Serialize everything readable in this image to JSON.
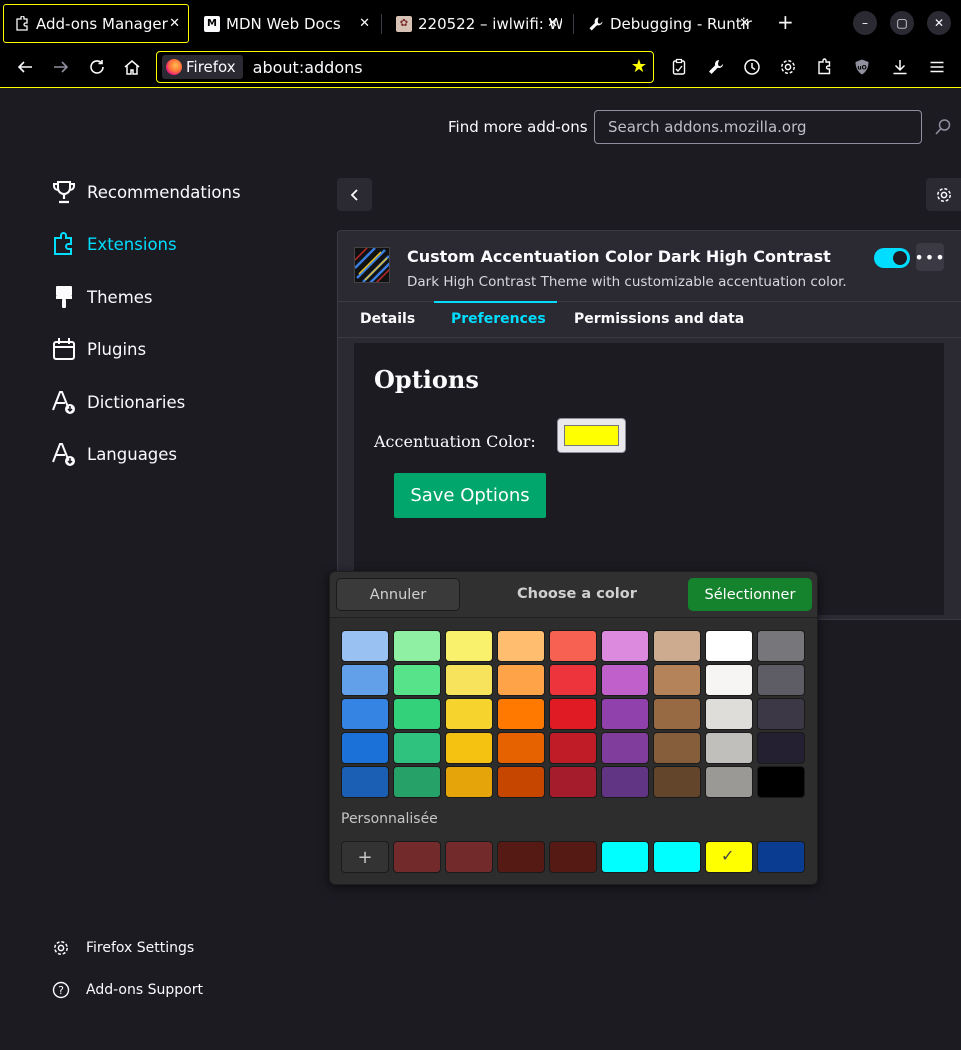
{
  "tabs": [
    {
      "label": "Add-ons Manager",
      "icon": "puzzle-icon",
      "active": true
    },
    {
      "label": "MDN Web Docs",
      "icon": "mdn-icon",
      "active": false
    },
    {
      "label": "220522 – iwlwifi: W",
      "icon": "bugzilla-icon",
      "active": false
    },
    {
      "label": "Debugging - Runtir",
      "icon": "wrench-icon",
      "active": false
    }
  ],
  "window": {
    "new_tab": "+",
    "minimize": "–",
    "maximize": "▢",
    "close": "✕"
  },
  "urlbar": {
    "identity": "Firefox",
    "url": "about:addons"
  },
  "header": {
    "find_label": "Find more add-ons",
    "search_placeholder": "Search addons.mozilla.org"
  },
  "categories": [
    {
      "label": "Recommendations",
      "icon": "trophy-icon",
      "selected": false
    },
    {
      "label": "Extensions",
      "icon": "extensions-icon",
      "selected": true
    },
    {
      "label": "Themes",
      "icon": "brush-icon",
      "selected": false
    },
    {
      "label": "Plugins",
      "icon": "plugin-icon",
      "selected": false
    },
    {
      "label": "Dictionaries",
      "icon": "dictionary-icon",
      "selected": false
    },
    {
      "label": "Languages",
      "icon": "language-icon",
      "selected": false
    }
  ],
  "footer": {
    "settings": "Firefox Settings",
    "support": "Add-ons Support"
  },
  "addon": {
    "name": "Custom Accentuation Color Dark High Contrast",
    "description": "Dark High Contrast Theme with customizable accentuation color.",
    "enabled": true,
    "tabs": [
      "Details",
      "Preferences",
      "Permissions and data"
    ],
    "selected_tab": "Preferences"
  },
  "options": {
    "title": "Options",
    "accent_label": "Accentuation Color:",
    "accent_value": "#ffff00",
    "save_label": "Save Options"
  },
  "color_dialog": {
    "cancel_label": "Annuler",
    "title": "Choose a color",
    "select_label": "Sélectionner",
    "custom_label": "Personnalisée",
    "add_custom": "+",
    "palette": [
      [
        "#99c1f1",
        "#8ff0a4",
        "#f9f06b",
        "#ffbe6f",
        "#f66151",
        "#dc8add",
        "#cdab8f",
        "#ffffff",
        "#77767b"
      ],
      [
        "#62a0ea",
        "#57e389",
        "#f8e45c",
        "#ffa348",
        "#ed333b",
        "#c061cb",
        "#b5835a",
        "#f6f5f4",
        "#5e5c64"
      ],
      [
        "#3584e4",
        "#33d17a",
        "#f6d32d",
        "#ff7800",
        "#e01b24",
        "#9141ac",
        "#986a44",
        "#deddda",
        "#3d3846"
      ],
      [
        "#1c71d8",
        "#2ec27e",
        "#f5c211",
        "#e66100",
        "#c01c28",
        "#813d9c",
        "#865e3c",
        "#c0bfbc",
        "#241f31"
      ],
      [
        "#1a5fb4",
        "#26a269",
        "#e5a50a",
        "#c64600",
        "#a51d2d",
        "#613583",
        "#63452c",
        "#9a9996",
        "#000000"
      ]
    ],
    "custom_colors": [
      "#722a2a",
      "#722a2a",
      "#551a14",
      "#551a14",
      "#00ffff",
      "#00ffff",
      "#ffff00",
      "#0a3d91"
    ],
    "selected_custom": 6
  }
}
